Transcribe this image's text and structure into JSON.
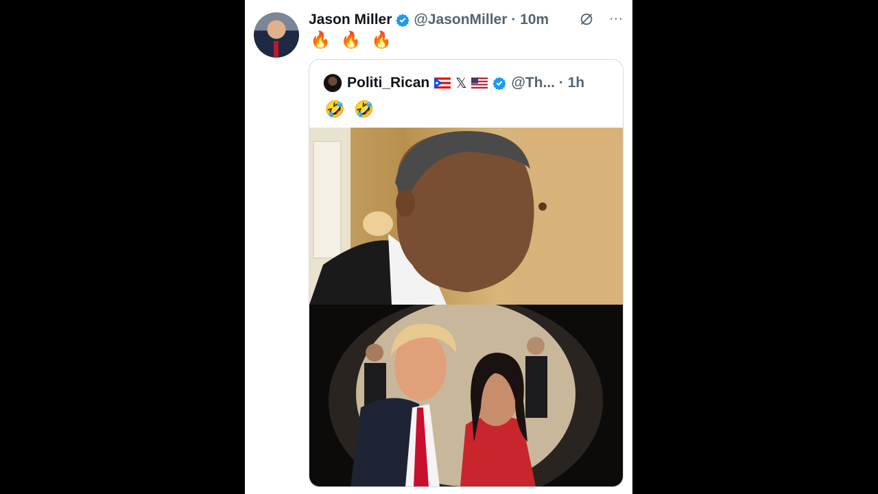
{
  "tweet": {
    "author_name": "Jason Miller",
    "handle_time": "@JasonMiller · 10m",
    "text": "🔥 🔥 🔥",
    "more_label": "···"
  },
  "quote": {
    "author_name": "Politi_Rican",
    "x_glyph": "𝕏",
    "handle_time": "@Th... · 1h",
    "text": "🤣 🤣"
  },
  "colors": {
    "verified": "#1d9bf0",
    "text": "#0f1419",
    "secondary": "#536471"
  }
}
